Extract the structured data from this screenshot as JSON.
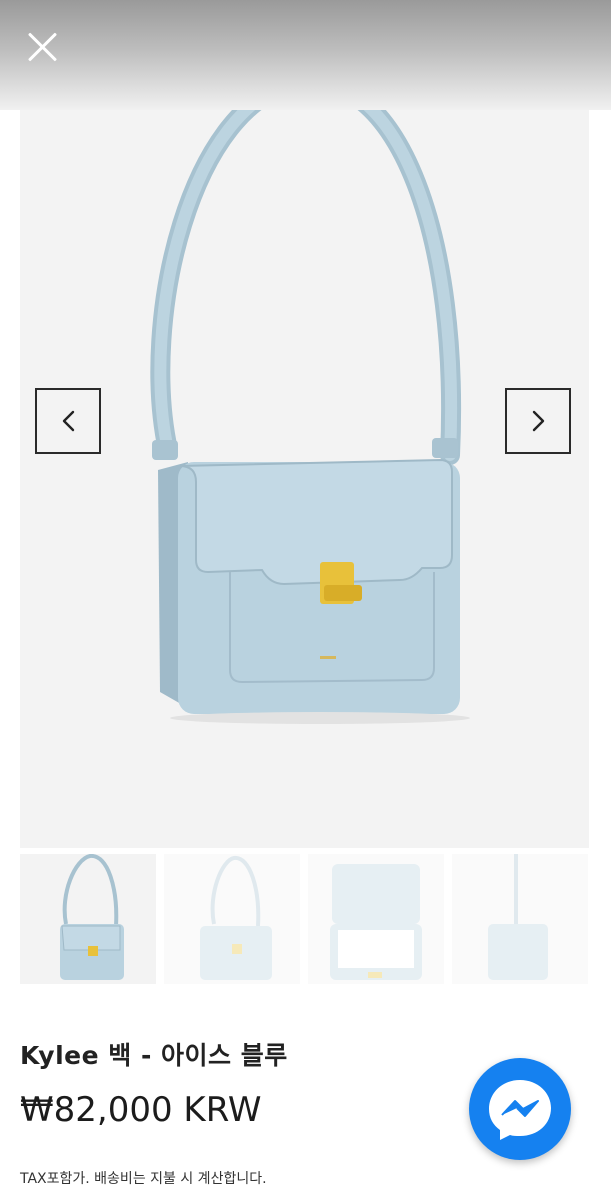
{
  "header": {
    "close_icon": "close-icon"
  },
  "gallery": {
    "prev_icon": "chevron-left-icon",
    "next_icon": "chevron-right-icon",
    "selected_index": 0,
    "thumbnail_count": 4,
    "bag_color": "#b9d2df",
    "clasp_color": "#e8c13a"
  },
  "product": {
    "title": "Kylee 백 - 아이스 블루",
    "price": "₩82,000 KRW",
    "tax_note": "TAX포함가. 배송비는 지불 시 계산합니다."
  },
  "chat": {
    "icon": "messenger-icon",
    "color": "#1581f0"
  }
}
